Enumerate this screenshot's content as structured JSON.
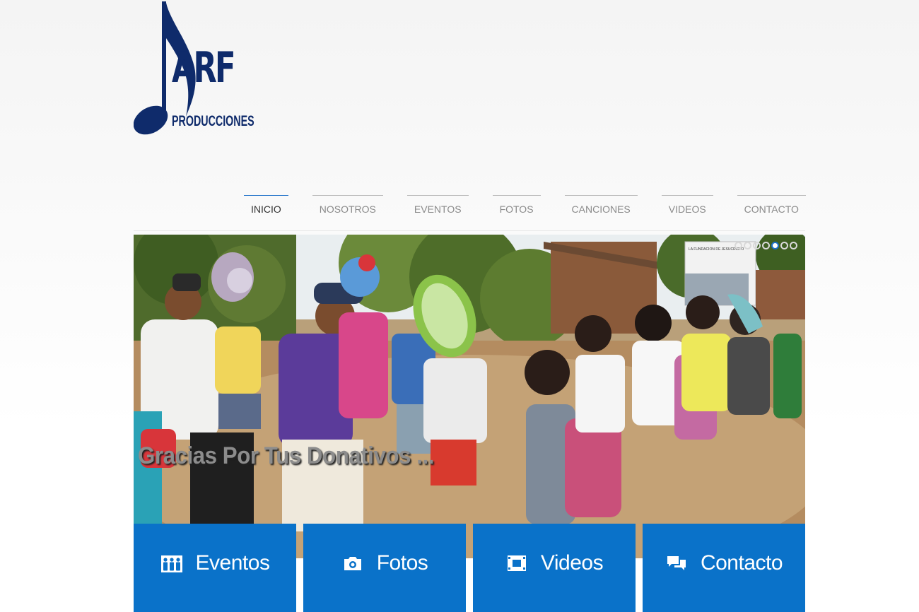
{
  "logo": {
    "brand": "ARF",
    "subtitle": "PRODUCCIONES"
  },
  "nav": {
    "items": [
      {
        "label": "INICIO",
        "active": true
      },
      {
        "label": "NOSOTROS",
        "active": false
      },
      {
        "label": "EVENTOS",
        "active": false
      },
      {
        "label": "FOTOS",
        "active": false
      },
      {
        "label": "CANCIONES",
        "active": false
      },
      {
        "label": "VIDEOS",
        "active": false
      },
      {
        "label": "CONTACTO",
        "active": false
      }
    ]
  },
  "slider": {
    "caption": "Gracias Por Tus Donativos ...",
    "slide_count": 7,
    "active_slide": 5,
    "truck_sign": "LA FUNDACION DE JESUCRISTO"
  },
  "tiles": [
    {
      "label": "Eventos",
      "icon": "people-icon"
    },
    {
      "label": "Fotos",
      "icon": "camera-icon"
    },
    {
      "label": "Videos",
      "icon": "film-icon"
    },
    {
      "label": "Contacto",
      "icon": "chat-bubbles-icon"
    }
  ],
  "colors": {
    "brand_navy": "#0f2b6b",
    "accent_blue": "#0a72c9",
    "nav_active_rule": "#1b6fc8"
  }
}
